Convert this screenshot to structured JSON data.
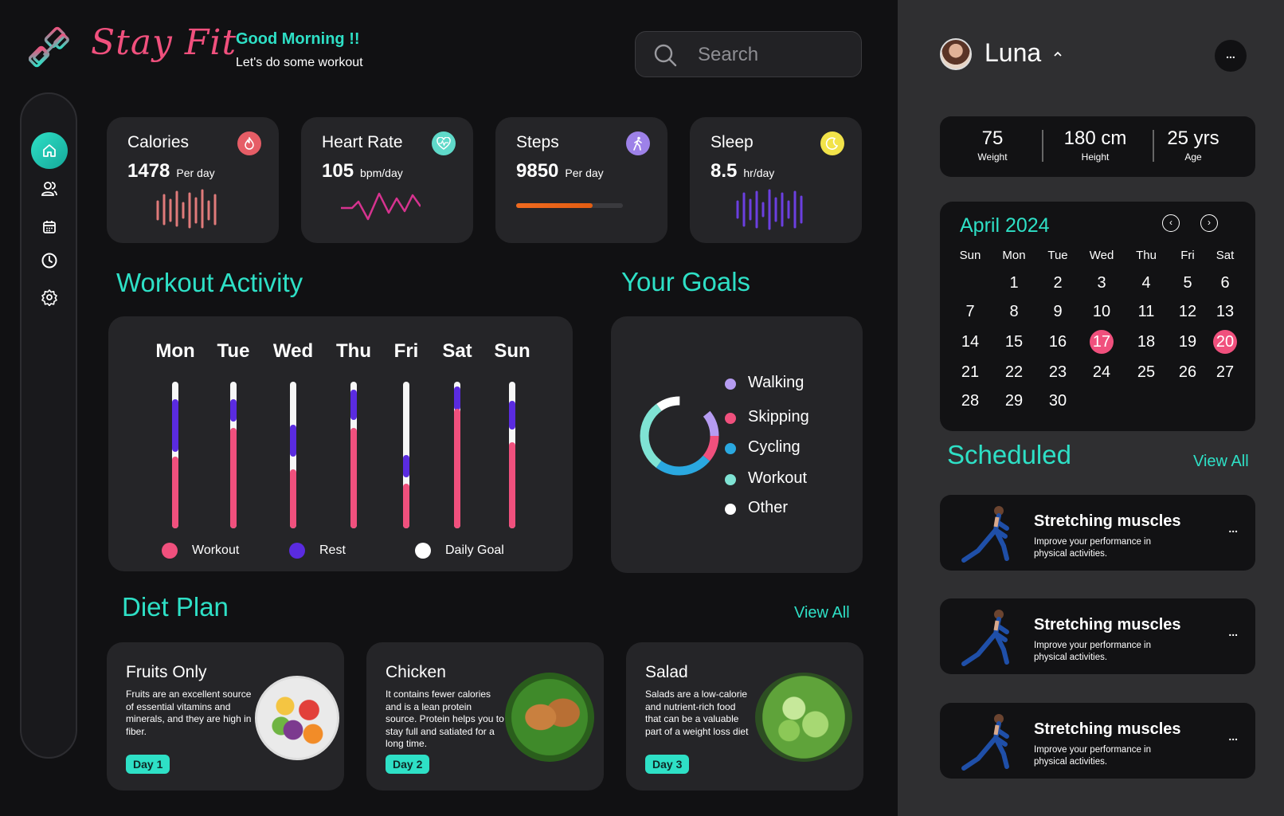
{
  "brand": {
    "name": "Stay Fit",
    "greeting": "Good Morning !!",
    "subgreeting": "Let's do some workout"
  },
  "search": {
    "placeholder": "Search"
  },
  "sidebar": {
    "items": [
      "home",
      "users",
      "calendar",
      "history",
      "settings"
    ]
  },
  "stats": [
    {
      "title": "Calories",
      "value": "1478",
      "unit": "Per day",
      "icon": "flame-icon"
    },
    {
      "title": "Heart Rate",
      "value": "105",
      "unit": "bpm/day",
      "icon": "heart-pulse-icon"
    },
    {
      "title": "Steps",
      "value": "9850",
      "unit": "Per day",
      "icon": "walking-icon",
      "progress": 0.72
    },
    {
      "title": "Sleep",
      "value": "8.5",
      "unit": "hr/day",
      "icon": "moon-icon"
    }
  ],
  "workout": {
    "title": "Workout Activity",
    "days": [
      "Mon",
      "Tue",
      "Wed",
      "Thu",
      "Fri",
      "Sat",
      "Sun"
    ],
    "legend": [
      "Workout",
      "Rest",
      "Daily Goal"
    ]
  },
  "goals": {
    "title": "Your Goals",
    "items": [
      {
        "label": "Walking",
        "color": "#b69cf2",
        "share": 0.14
      },
      {
        "label": "Skipping",
        "color": "#f0507d",
        "share": 0.22
      },
      {
        "label": "Cycling",
        "color": "#2aa8e0",
        "share": 0.24
      },
      {
        "label": "Workout",
        "color": "#7fe3d4",
        "share": 0.3
      },
      {
        "label": "Other",
        "color": "#ffffff",
        "share": 0.1
      }
    ]
  },
  "diet": {
    "title": "Diet Plan",
    "view_all": "View All",
    "items": [
      {
        "title": "Fruits Only",
        "desc": "Fruits are an excellent source of essential vitamins and minerals, and they are high in fiber.",
        "badge": "Day 1"
      },
      {
        "title": "Chicken",
        "desc": "It contains fewer calories and is a lean protein source. Protein helps you to stay full and satiated for a long time.",
        "badge": "Day 2"
      },
      {
        "title": "Salad",
        "desc": "Salads are a low-calorie and nutrient-rich food that can be a valuable part of a weight loss diet",
        "badge": "Day 3"
      }
    ]
  },
  "user": {
    "name": "Luna",
    "more": "..."
  },
  "metrics": [
    {
      "value": "75",
      "label": "Weight"
    },
    {
      "value": "180 cm",
      "label": "Height"
    },
    {
      "value": "25 yrs",
      "label": "Age"
    }
  ],
  "calendar": {
    "title": "April 2024",
    "prev": "‹",
    "next": "›",
    "headers": [
      "Sun",
      "Mon",
      "Tue",
      "Wed",
      "Thu",
      "Fri",
      "Sat"
    ],
    "start_weekday": 1,
    "days_in_month": 30,
    "highlighted": [
      17,
      20
    ]
  },
  "scheduled": {
    "title": "Scheduled",
    "view_all": "View All",
    "items": [
      {
        "title": "Stretching muscles",
        "desc": "Improve your performance in physical activities."
      },
      {
        "title": "Stretching muscles",
        "desc": "Improve your performance in physical activities."
      },
      {
        "title": "Stretching muscles",
        "desc": "Improve your performance in physical activities."
      }
    ]
  }
}
